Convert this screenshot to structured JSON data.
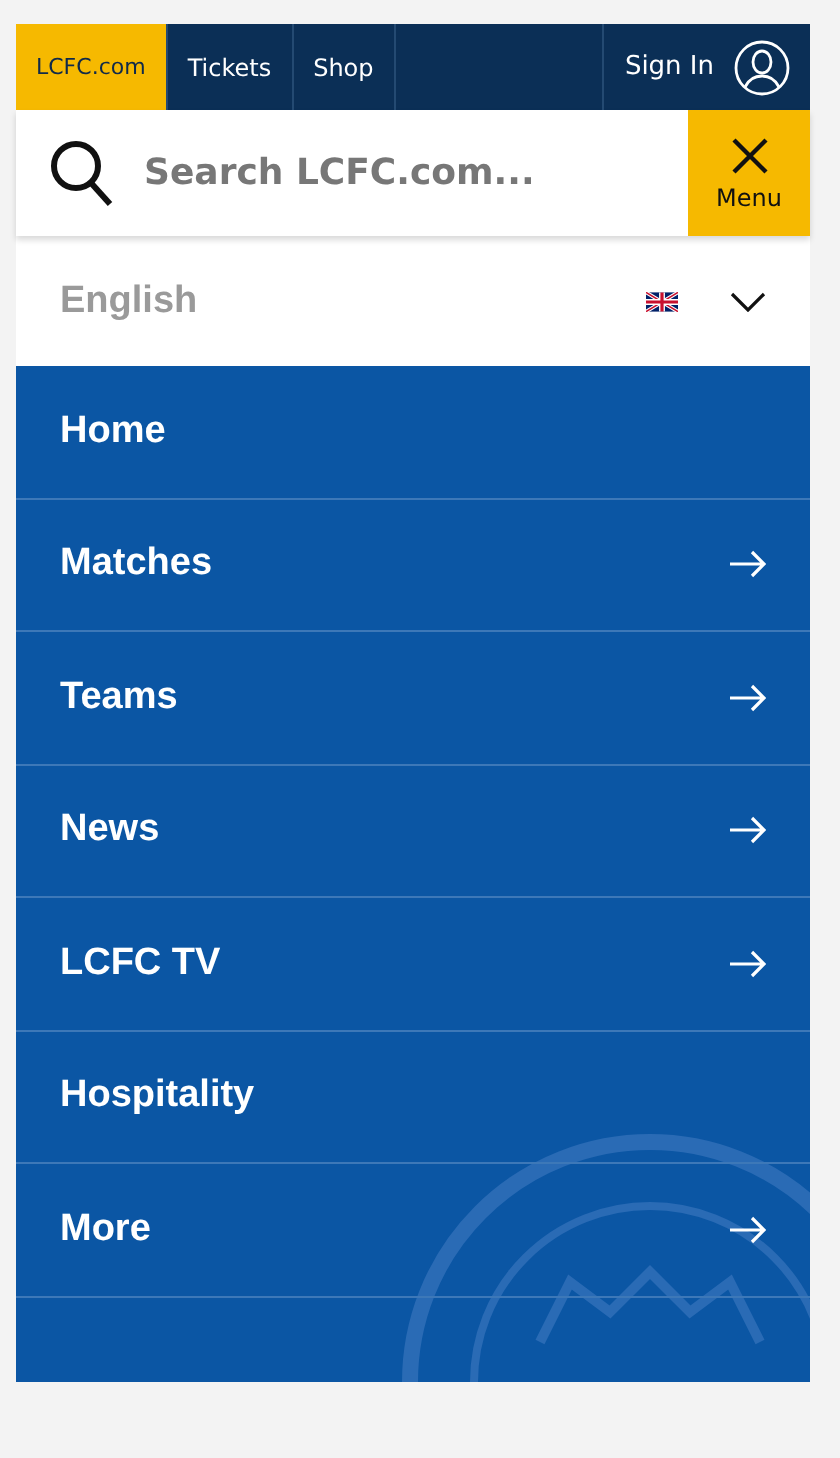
{
  "top_nav": {
    "tabs": [
      {
        "label": "LCFC.com",
        "selected": true
      },
      {
        "label": "Tickets",
        "selected": false
      },
      {
        "label": "Shop",
        "selected": false
      }
    ],
    "sign_in": "Sign In"
  },
  "search": {
    "placeholder": "Search LCFC.com...",
    "menu_label": "Menu"
  },
  "language": {
    "value": "English"
  },
  "menu": [
    {
      "label": "Home",
      "has_arrow": false
    },
    {
      "label": "Matches",
      "has_arrow": true
    },
    {
      "label": "Teams",
      "has_arrow": true
    },
    {
      "label": "News",
      "has_arrow": true
    },
    {
      "label": "LCFC TV",
      "has_arrow": true
    },
    {
      "label": "Hospitality",
      "has_arrow": false
    },
    {
      "label": "More",
      "has_arrow": true
    }
  ]
}
